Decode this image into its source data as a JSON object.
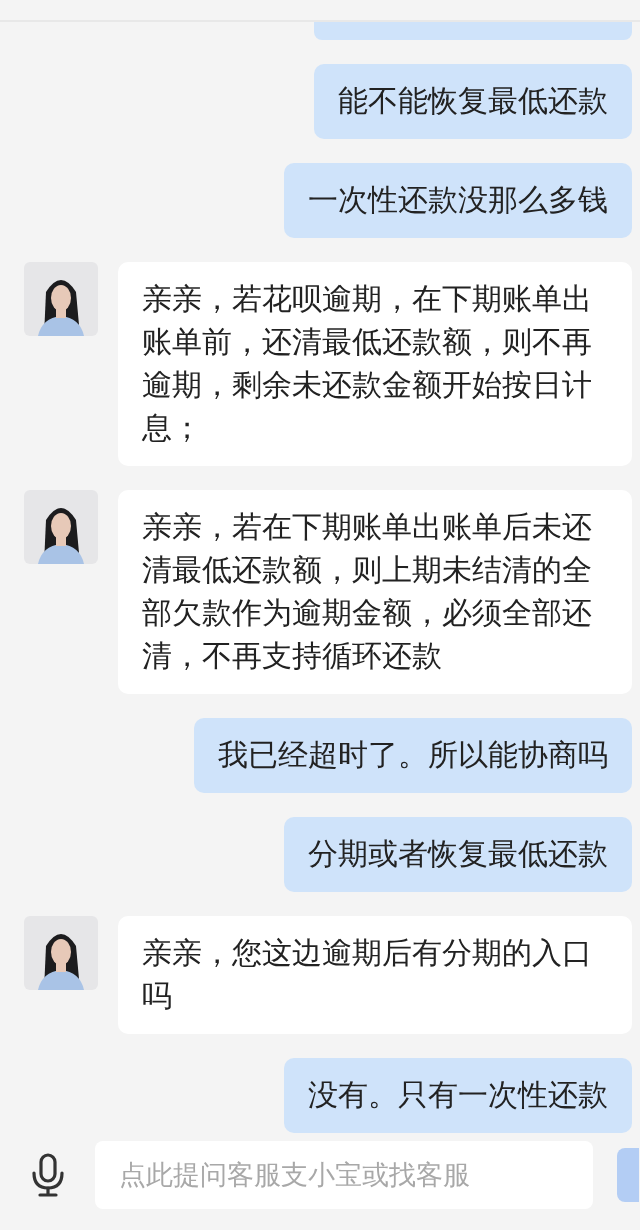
{
  "messages": [
    {
      "outgoing": true,
      "kind": "cut"
    },
    {
      "outgoing": true,
      "kind": "text",
      "text": "能不能恢复最低还款"
    },
    {
      "outgoing": true,
      "kind": "text",
      "text": "一次性还款没那么多钱"
    },
    {
      "outgoing": false,
      "kind": "text",
      "text": "亲亲，若花呗逾期，在下期账单出账单前，还清最低还款额，则不再逾期，剩余未还款金额开始按日计息；"
    },
    {
      "outgoing": false,
      "kind": "text",
      "text": "亲亲，若在下期账单出账单后未还清最低还款额，则上期未结清的全部欠款作为逾期金额，必须全部还清，不再支持循环还款"
    },
    {
      "outgoing": true,
      "kind": "text",
      "text": "我已经超时了。所以能协商吗"
    },
    {
      "outgoing": true,
      "kind": "text",
      "text": "分期或者恢复最低还款"
    },
    {
      "outgoing": false,
      "kind": "text",
      "text": "亲亲，您这边逾期后有分期的入口吗"
    },
    {
      "outgoing": true,
      "kind": "text",
      "text": "没有。只有一次性还款"
    }
  ],
  "input": {
    "placeholder": "点此提问客服支小宝或找客服"
  }
}
